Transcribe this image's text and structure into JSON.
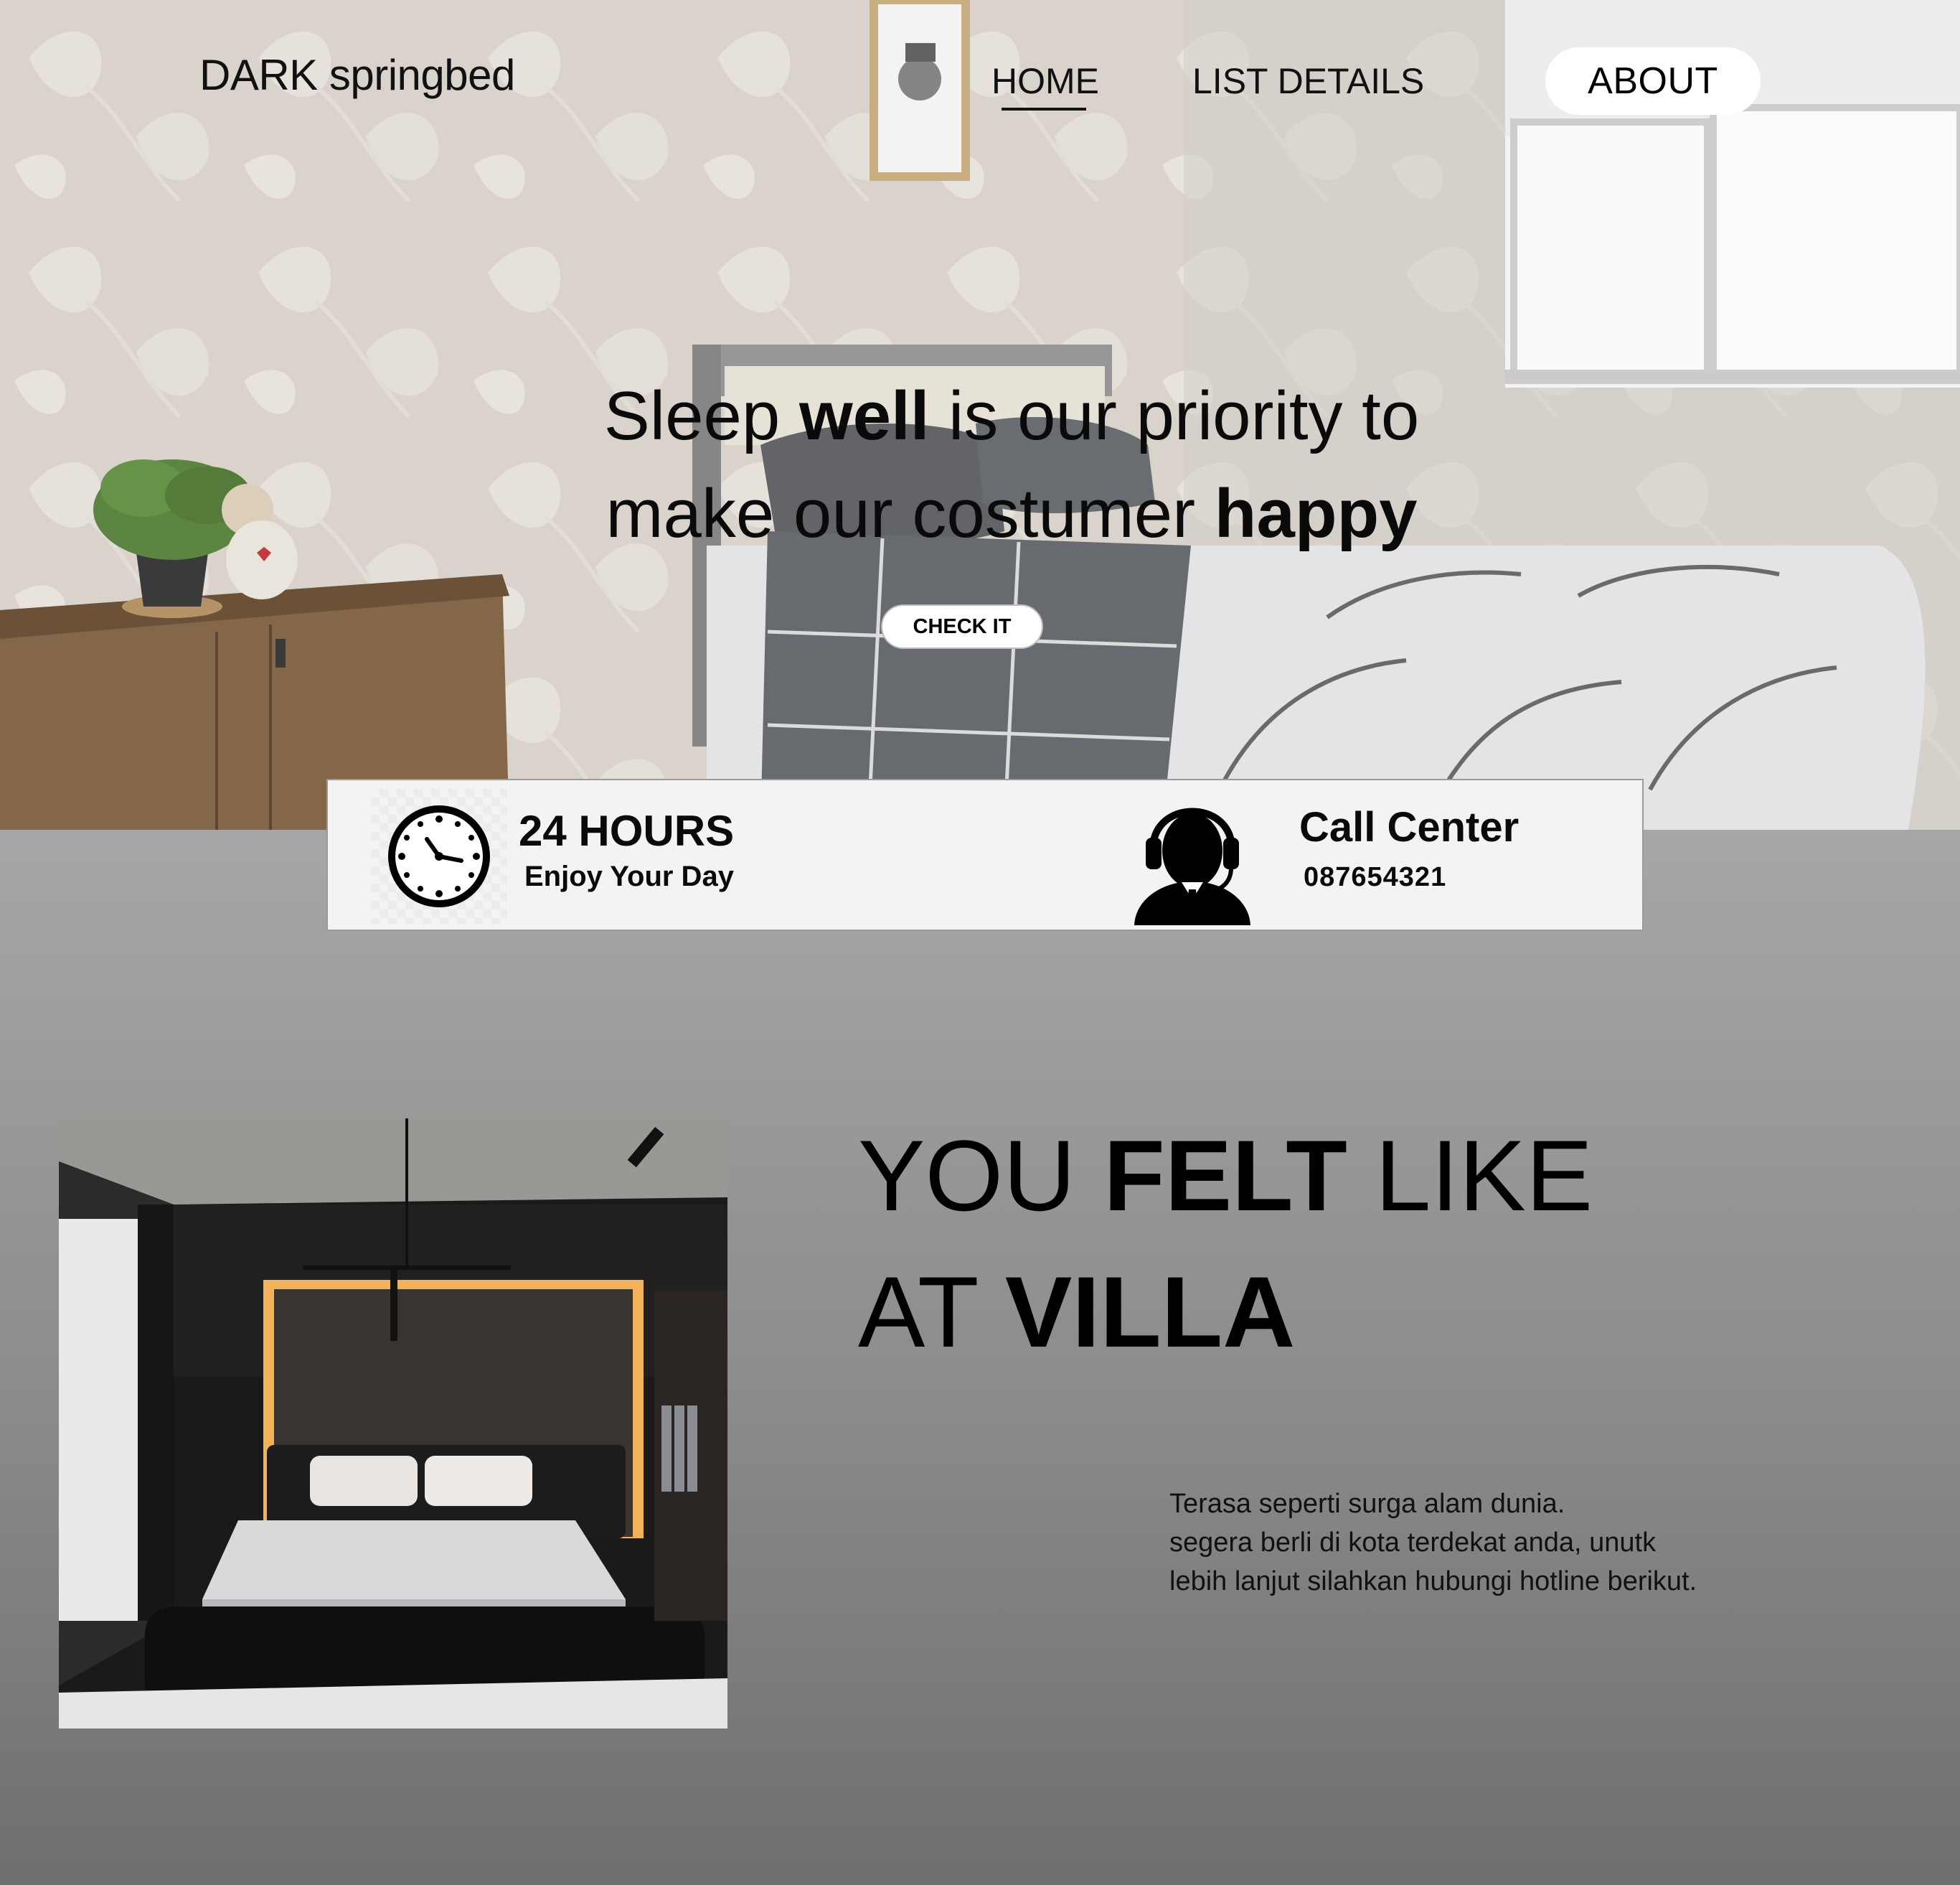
{
  "brand": "DARK springbed",
  "nav": {
    "home": "HOME",
    "list_details": "LIST DETAILS",
    "about": "ABOUT"
  },
  "hero": {
    "line1_a": "Sleep ",
    "line1_b": "well",
    "line1_c": " is our priority to",
    "line2_a": "make our costumer ",
    "line2_b": "happy",
    "cta": "CHECK IT"
  },
  "info": {
    "hours_title": "24 HOURS",
    "hours_sub": "Enjoy Your Day",
    "call_title": "Call Center",
    "call_number": "087654321",
    "icons": [
      "clock-icon",
      "call-center-agent-icon"
    ]
  },
  "villa": {
    "line1_a": "YOU ",
    "line1_b": "FELT",
    "line1_c": " LIKE",
    "line2_a": "AT ",
    "line2_b": "VILLA",
    "paragraph": [
      "Terasa seperti surga alam dunia.",
      "segera berli di kota terdekat anda, unutk",
      "lebih lanjut silahkan hubungi hotline berikut."
    ]
  },
  "colors": {
    "hero_wall": "#d8d3cc",
    "page_gray_top": "#a9a9a9",
    "page_gray_bottom": "#6f6f6f",
    "info_bar_bg": "#f3f3f3",
    "text": "#0a0a0a"
  }
}
